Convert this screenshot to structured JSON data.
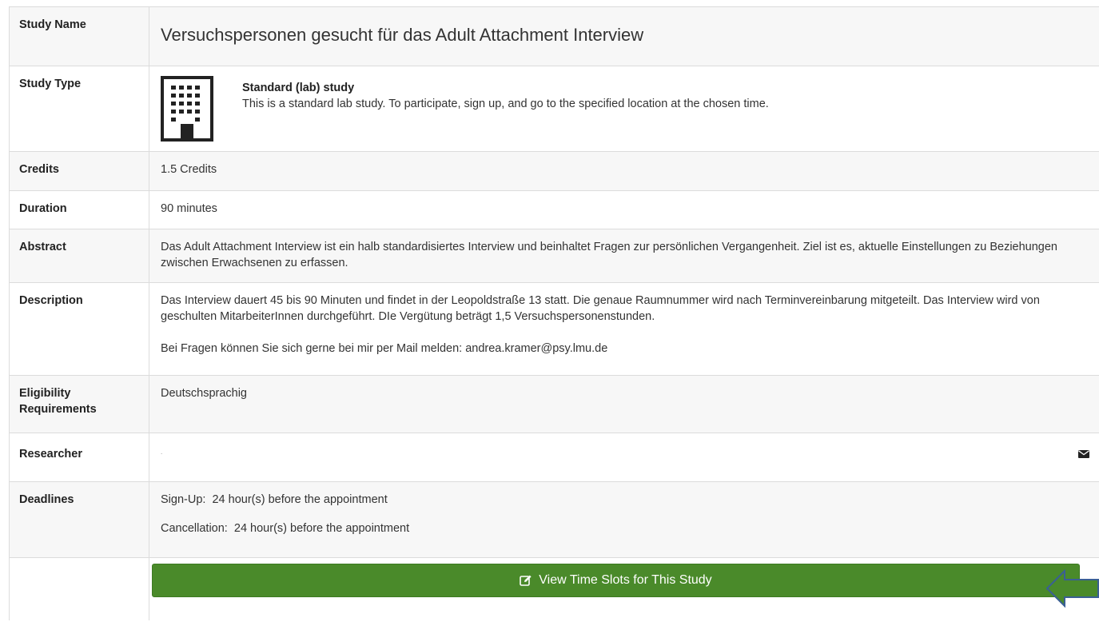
{
  "rows": {
    "study_name": {
      "label": "Study Name",
      "value": "Versuchspersonen gesucht für das Adult Attachment Interview"
    },
    "study_type": {
      "label": "Study Type",
      "title": "Standard (lab) study",
      "description": "This is a standard lab study. To participate, sign up, and go to the specified location at the chosen time.",
      "icon": "building-icon"
    },
    "credits": {
      "label": "Credits",
      "value": "1.5 Credits"
    },
    "duration": {
      "label": "Duration",
      "value": "90 minutes"
    },
    "abstract": {
      "label": "Abstract",
      "value": "Das Adult Attachment Interview ist ein halb standardisiertes Interview und beinhaltet Fragen zur persönlichen Vergangenheit. Ziel ist es, aktuelle Einstellungen zu Beziehungen zwischen Erwachsenen zu erfassen."
    },
    "description": {
      "label": "Description",
      "para1": "Das Interview dauert 45 bis 90 Minuten und findet in der Leopoldstraße 13 statt. Die genaue Raumnummer wird nach Terminvereinbarung mitgeteilt. Das Interview wird von geschulten MitarbeiterInnen durchgeführt. DIe Vergütung beträgt 1,5 Versuchspersonenstunden.",
      "para2": "Bei Fragen können Sie sich gerne bei mir per Mail melden: andrea.kramer@psy.lmu.de"
    },
    "eligibility": {
      "label": "Eligibility Requirements",
      "value": "Deutschsprachig"
    },
    "researcher": {
      "label": "Researcher",
      "value": ".",
      "icon": "envelope-icon"
    },
    "deadlines": {
      "label": "Deadlines",
      "signup": "Sign-Up:  24 hour(s) before the appointment",
      "cancellation": "Cancellation:  24 hour(s) before the appointment"
    }
  },
  "action": {
    "label": "View Time Slots for This Study",
    "icon": "edit-icon",
    "color": "#4a8a2a"
  },
  "annotation": {
    "icon": "left-arrow-icon",
    "color": "#3a5f94"
  }
}
